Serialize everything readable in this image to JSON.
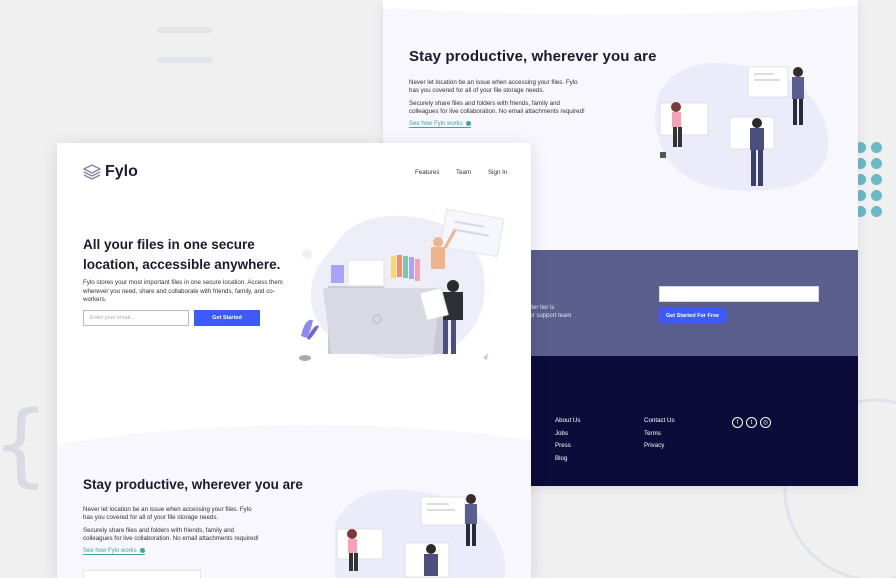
{
  "brand": {
    "name": "Fylo",
    "accent": "#3d5afe",
    "teal": "#3ba6a3",
    "footer_bg": "#0c0c3b",
    "cta_bg": "#5a5f8e"
  },
  "nav": {
    "features": "Features",
    "team": "Team",
    "signin": "Sign In"
  },
  "hero": {
    "title": "All your files in one secure location, accessible anywhere.",
    "body": "Fylo stores your most important files in one secure location. Access them wherever you need, share and collaborate with friends, family, and co-workers.",
    "email_placeholder": "Enter your email...",
    "cta": "Get Started"
  },
  "productive": {
    "title": "Stay productive, wherever you are",
    "p1": "Never let location be an issue when accessing your files. Fylo has you covered for all of your file storage needs.",
    "p2": "Securely share files and folders with friends, family and colleagues for live collaboration. No email attachments required!",
    "link": "See how Fylo works"
  },
  "cta_section": {
    "text_line1": "arter tier is",
    "text_line2": "our support team",
    "button": "Get Started For Free"
  },
  "footer": {
    "col1": [
      "About Us",
      "Jobs",
      "Press",
      "Blog"
    ],
    "col2": [
      "Contact Us",
      "Terms",
      "Privacy"
    ],
    "social": [
      "facebook-icon",
      "twitter-icon",
      "instagram-icon"
    ]
  }
}
